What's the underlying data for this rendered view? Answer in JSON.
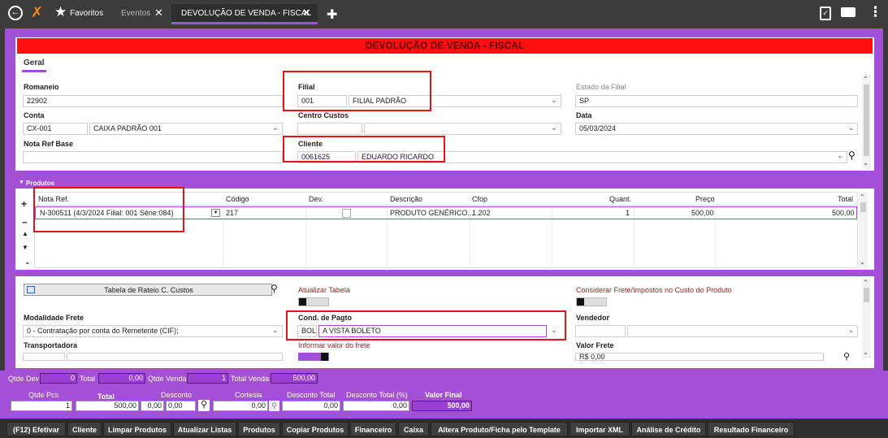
{
  "tabs": {
    "favorites": "Favoritos",
    "events": "Eventos",
    "active": "DEVOLUÇÃO DE VENDA - FISCAL"
  },
  "form": {
    "title": "DEVOLUÇÃO DE VENDA - FISCAL",
    "section_tab": "Geral",
    "romaneio": {
      "label": "Romaneio",
      "value": "22902"
    },
    "filial": {
      "label": "Filial",
      "code": "001",
      "name": "FILIAL PADRÃO"
    },
    "estado_filial": {
      "label": "Estado da Filial",
      "value": "SP"
    },
    "conta": {
      "label": "Conta",
      "code": "CX-001",
      "name": "CAIXA PADRÃO 001"
    },
    "centro_custos": {
      "label": "Centro Custos",
      "code": "",
      "name": ""
    },
    "data": {
      "label": "Data",
      "value": "05/03/2024"
    },
    "nota_ref_base": {
      "label": "Nota Ref Base",
      "value": ""
    },
    "cliente": {
      "label": "Cliente",
      "code": "0061625",
      "name": "EDUARDO RICARDO"
    }
  },
  "produtos": {
    "title": "Produtos",
    "columns": [
      "Nota Ref.",
      "Código",
      "Dev.",
      "Descrição",
      "Cfop",
      "Quant.",
      "Preço",
      "Total"
    ],
    "rows": [
      {
        "nota_ref": "N-300511 (4/3/2024 Filial: 001 Série:084)",
        "codigo": "217",
        "dev": "",
        "descricao": "PRODUTO GENÉRICO...",
        "cfop": "1.202",
        "quant": "1",
        "preco": "500,00",
        "total": "500,00"
      }
    ]
  },
  "lower": {
    "rateio_button": "Tabela de Rateio C. Custos",
    "atualizar_tabela": "Atualizar Tabela",
    "considerar_frete": "Considerar Frete/Impostos no Custo do Produto",
    "modalidade_frete": {
      "label": "Modalidade Frete",
      "value": "0 - Contratação por conta do Remetente (CIF);"
    },
    "cond_pagto": {
      "label": "Cond. de Pagto",
      "code": "BOL",
      "name": "A VISTA BOLETO"
    },
    "vendedor": {
      "label": "Vendedor",
      "code": "",
      "name": ""
    },
    "transportadora": {
      "label": "Transportadora"
    },
    "informar_valor_frete": "Informar valor do frete",
    "valor_frete": {
      "label": "Valor Frete",
      "value": "R$ 0,00"
    }
  },
  "totals": {
    "qtde_dev": {
      "label": "Qtde Dev",
      "value": "0"
    },
    "total": {
      "label": "Total",
      "value": "0,00"
    },
    "qtde_venda": {
      "label": "Qtde Venda",
      "value": "1"
    },
    "total_venda": {
      "label": "Total Venda",
      "value": "500,00"
    },
    "qtde_pcs": {
      "label": "Qtde Pcs",
      "value": "1"
    },
    "total2": {
      "label": "Total",
      "value": "500,00"
    },
    "desconto": {
      "label": "Desconto",
      "pct": "0,00",
      "value": "0,00"
    },
    "cortesia": {
      "label": "Cortesia",
      "value": "0,00"
    },
    "desconto_total": {
      "label": "Desconto Total",
      "value": "0,00"
    },
    "desconto_total_pct": {
      "label": "Desconto Total (%)",
      "value": "0,00"
    },
    "valor_final": {
      "label": "Valor Final",
      "value": "500,00"
    }
  },
  "buttons": [
    "(F12) Efetivar",
    "Cliente",
    "Limpar Produtos",
    "Atualizar Listas",
    "Produtos",
    "Copiar Produtos",
    "Financeiro",
    "Caixa",
    "Altera Produto/Ficha pelo Template",
    "Importar XML",
    "Análise de Crédito",
    "Resultado Financeiro"
  ],
  "colors": {
    "accent": "#a44fd8",
    "banner": "#ff1010",
    "highlight": "#e0141a"
  }
}
